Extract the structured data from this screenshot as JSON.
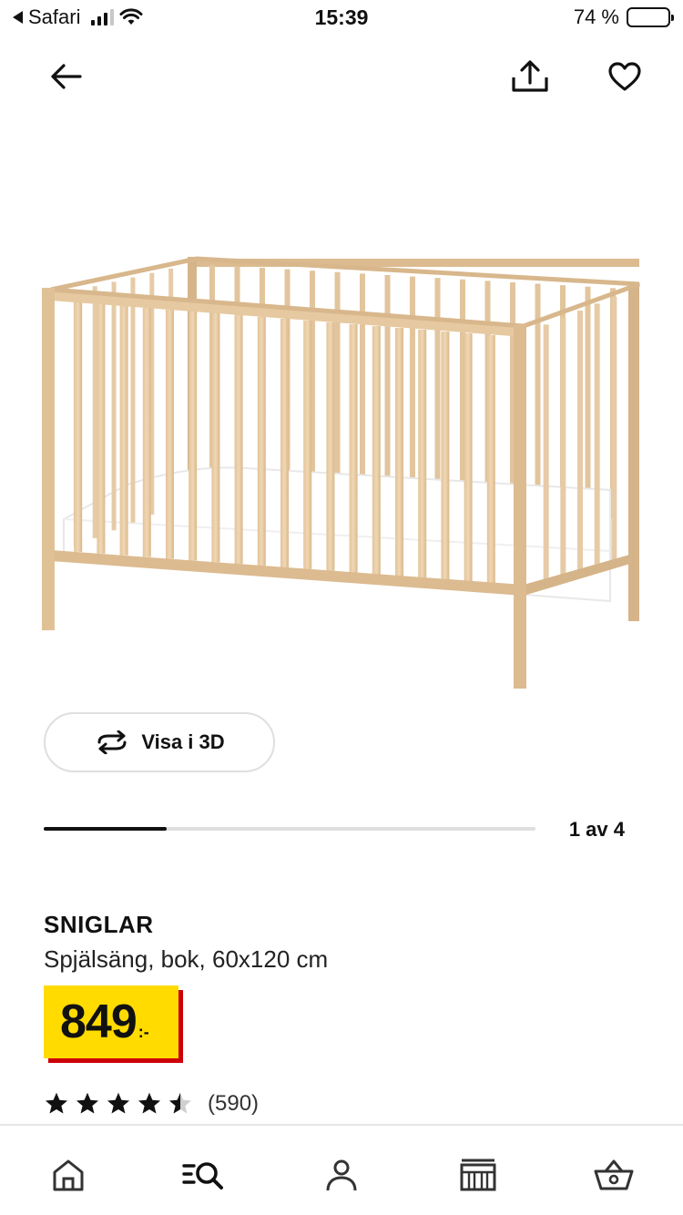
{
  "status_bar": {
    "back_app": "Safari",
    "time": "15:39",
    "battery": "74 %",
    "battery_level": 0.74
  },
  "top_nav": {
    "back_icon": "arrow-left-icon",
    "share_icon": "share-icon",
    "favorite_icon": "heart-icon"
  },
  "gallery": {
    "view_3d_label": "Visa i 3D",
    "view_3d_icon": "rotate-3d-icon",
    "pager_label": "1 av 4",
    "current": 1,
    "total": 4
  },
  "product": {
    "name": "SNIGLAR",
    "description": "Spjälsäng, bok, 60x120 cm",
    "price": "849",
    "price_suffix": ":-",
    "rating": 4.5,
    "rating_count": "(590)"
  },
  "colors": {
    "price_bg": "#ffdb00",
    "price_shadow": "#cc0008",
    "icon": "#111111",
    "nav_icon": "#333333"
  },
  "bottom_nav": {
    "items": [
      "home-icon",
      "search-icon",
      "profile-icon",
      "store-icon",
      "cart-icon"
    ],
    "active": "search-icon"
  }
}
